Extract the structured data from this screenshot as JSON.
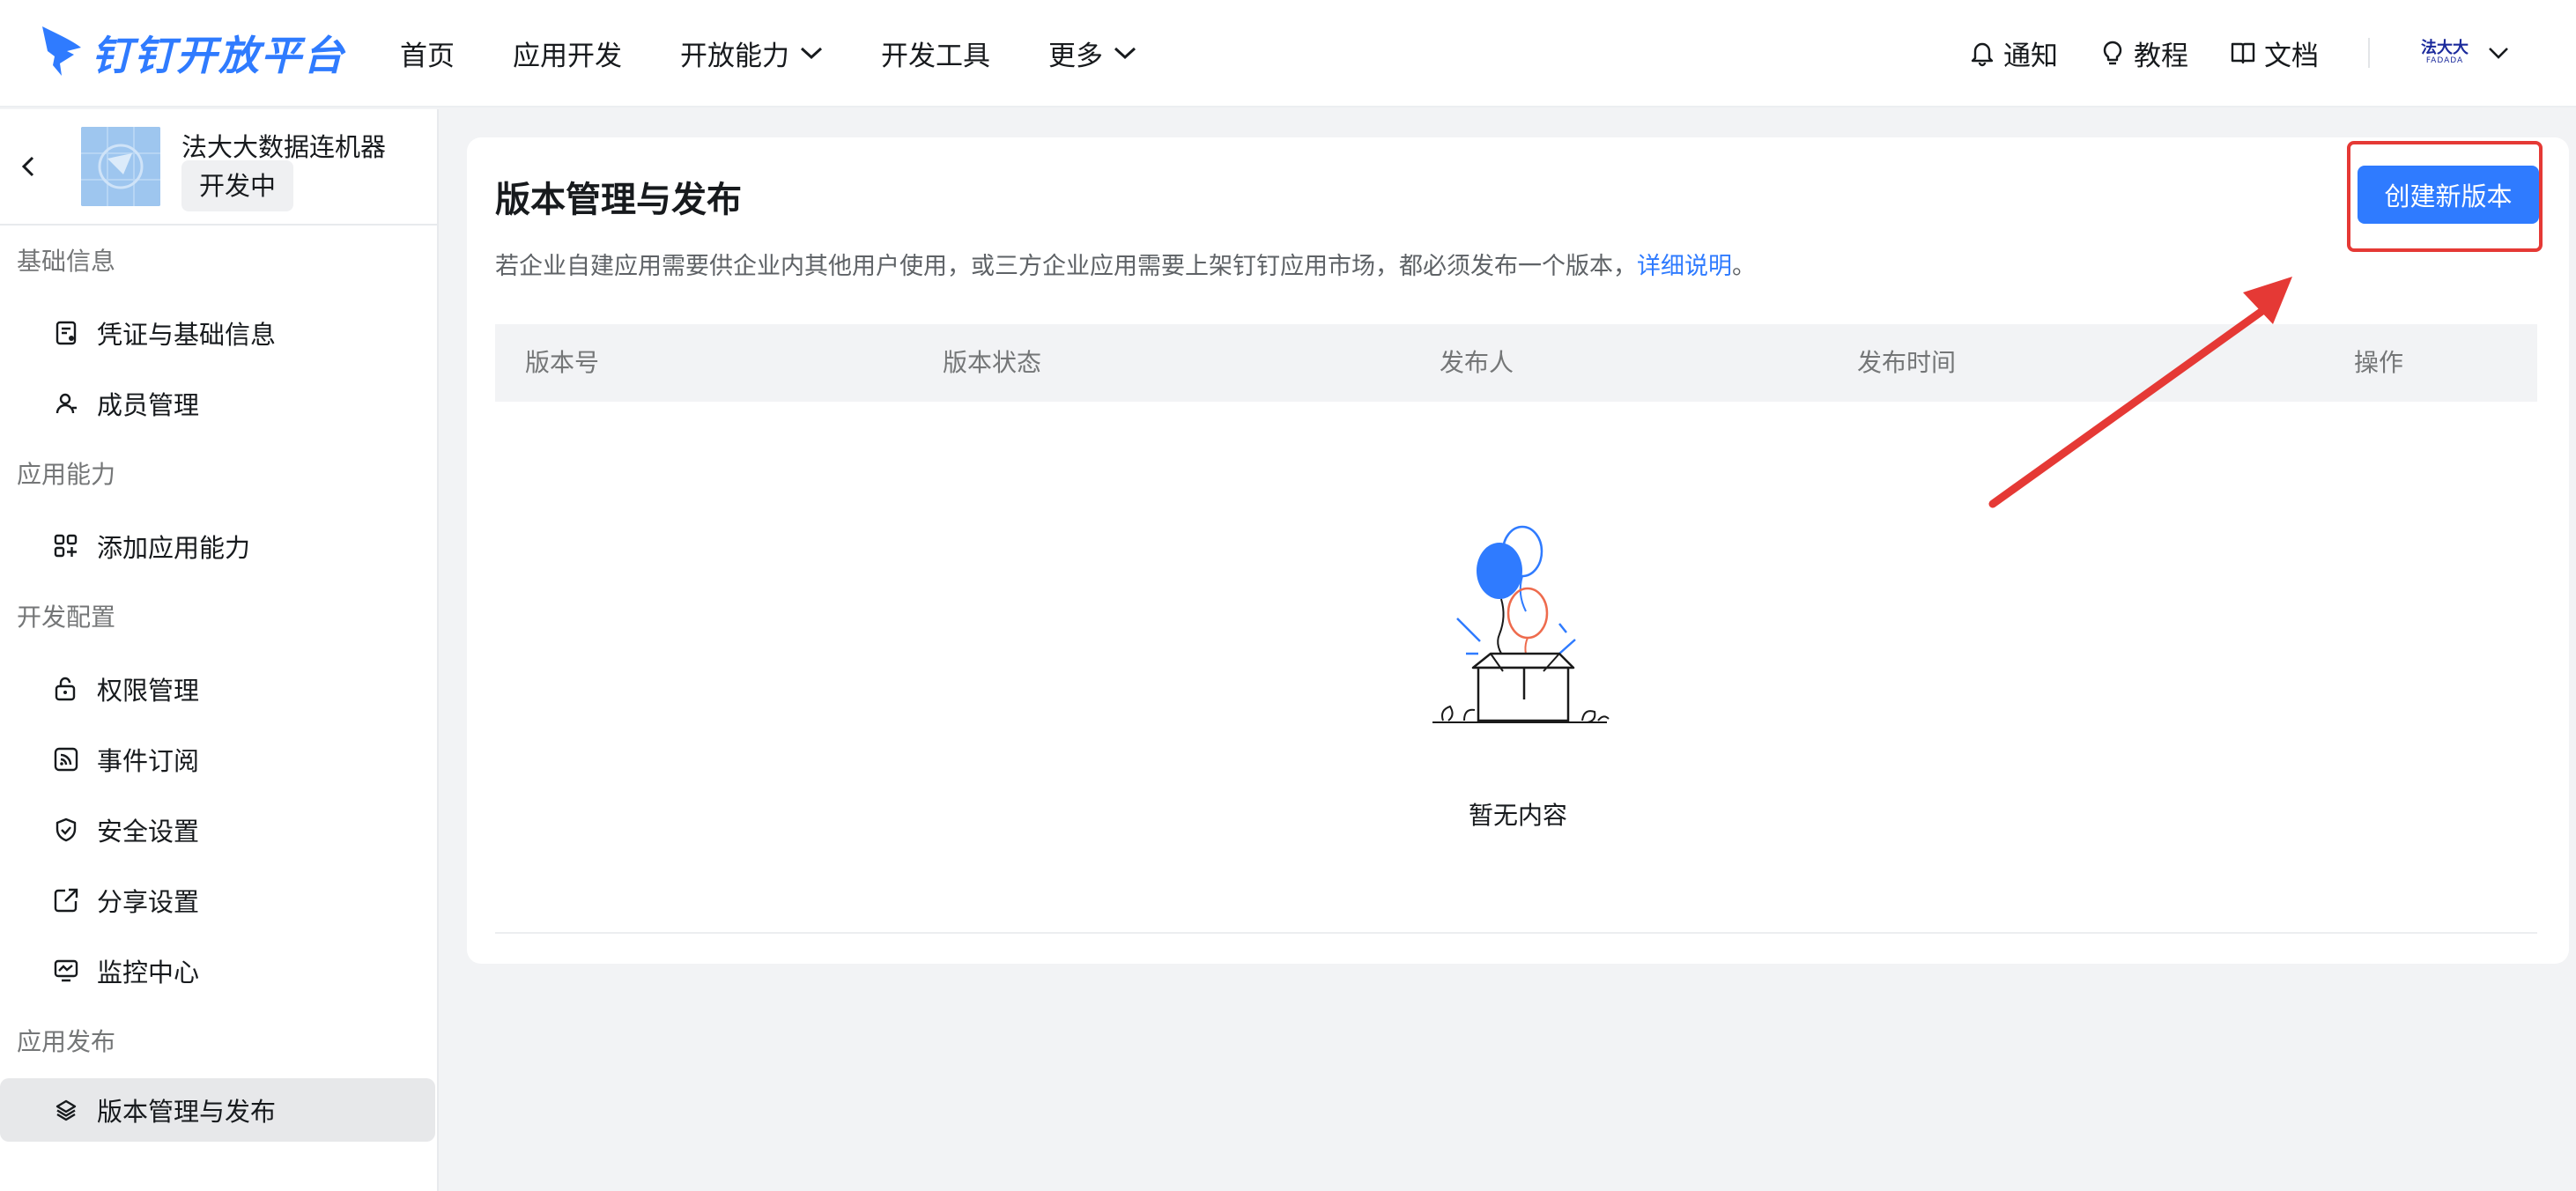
{
  "header": {
    "logo_text": "钉钉开放平台",
    "nav": [
      {
        "label": "首页",
        "has_dropdown": false
      },
      {
        "label": "应用开发",
        "has_dropdown": false
      },
      {
        "label": "开放能力",
        "has_dropdown": true
      },
      {
        "label": "开发工具",
        "has_dropdown": false
      },
      {
        "label": "更多",
        "has_dropdown": true
      }
    ],
    "right": {
      "notify": "通知",
      "tutorial": "教程",
      "docs": "文档"
    },
    "org_logo": {
      "top": "法大大",
      "bottom": "FADADA"
    }
  },
  "sidebar": {
    "app_name": "法大大数据连机器",
    "app_status": "开发中",
    "groups": [
      {
        "title": "基础信息",
        "items": [
          {
            "label": "凭证与基础信息",
            "icon": "credential-icon"
          },
          {
            "label": "成员管理",
            "icon": "member-icon"
          }
        ]
      },
      {
        "title": "应用能力",
        "items": [
          {
            "label": "添加应用能力",
            "icon": "add-capability-icon"
          }
        ]
      },
      {
        "title": "开发配置",
        "items": [
          {
            "label": "权限管理",
            "icon": "lock-icon"
          },
          {
            "label": "事件订阅",
            "icon": "rss-icon"
          },
          {
            "label": "安全设置",
            "icon": "shield-icon"
          },
          {
            "label": "分享设置",
            "icon": "share-icon"
          },
          {
            "label": "监控中心",
            "icon": "monitor-icon"
          }
        ]
      },
      {
        "title": "应用发布",
        "items": [
          {
            "label": "版本管理与发布",
            "icon": "layers-icon",
            "active": true
          }
        ]
      }
    ]
  },
  "main": {
    "title": "版本管理与发布",
    "description": "若企业自建应用需要供企业内其他用户使用，或三方企业应用需要上架钉钉应用市场，都必须发布一个版本，",
    "description_link": "详细说明",
    "description_end": "。",
    "create_button": "创建新版本",
    "table_headers": [
      "版本号",
      "版本状态",
      "发布人",
      "发布时间",
      "操作"
    ],
    "empty_text": "暂无内容"
  },
  "colors": {
    "accent": "#2f7bff",
    "annotation": "#e53935"
  }
}
